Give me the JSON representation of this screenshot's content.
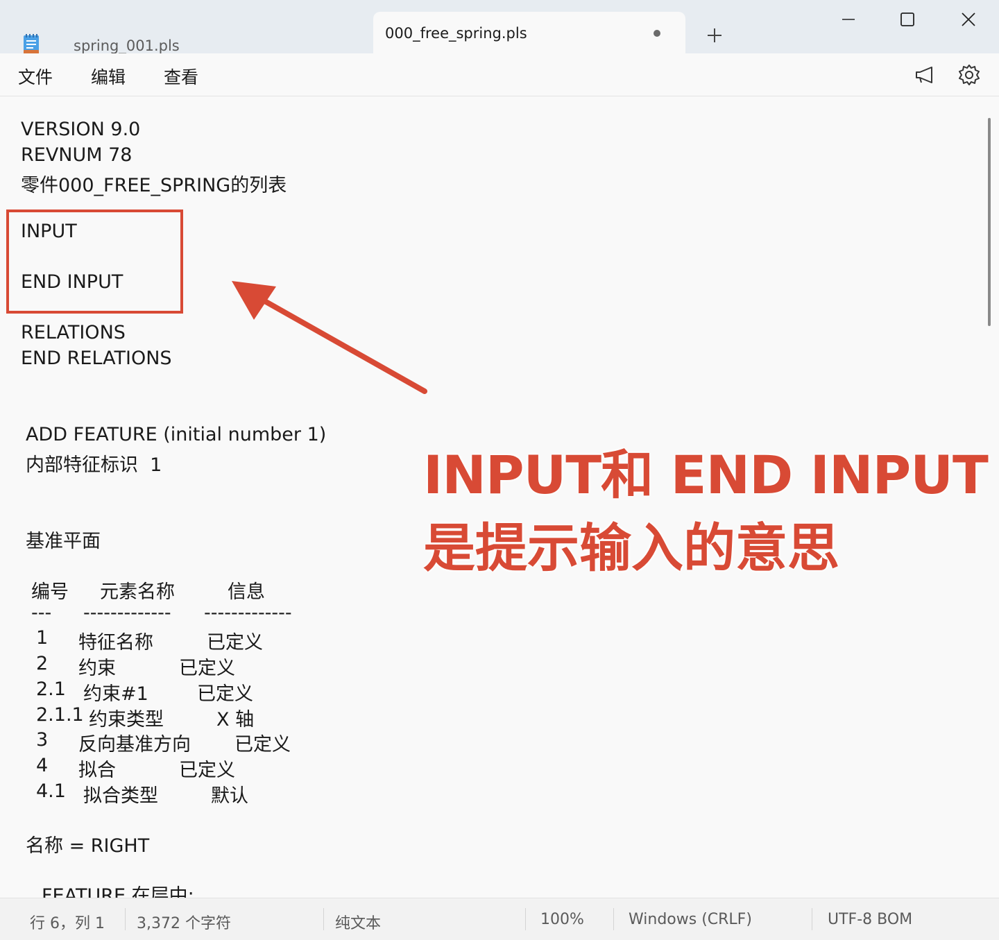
{
  "tabs": [
    {
      "title": "spring_001.pls",
      "active": false
    },
    {
      "title": "000_free_spring.pls",
      "active": true,
      "unsaved": true
    }
  ],
  "new_tab_icon": "plus-icon",
  "window_controls": [
    "minimize-icon",
    "maximize-icon",
    "close-icon"
  ],
  "menu": {
    "file": "文件",
    "edit": "编辑",
    "view": "查看"
  },
  "toolbar_icons": [
    "megaphone-icon",
    "gear-icon"
  ],
  "editor": {
    "lines": [
      "VERSION 9.0",
      "REVNUM 78",
      "零件000_FREE_SPRING的列表",
      "INPUT",
      "END INPUT",
      "RELATIONS",
      "END RELATIONS",
      "ADD FEATURE (initial number 1)",
      "内部特征标识  1",
      "基准平面"
    ],
    "table_header": {
      "col1": "编号",
      "col2": "元素名称",
      "col3": "信息"
    },
    "table_separator": {
      "col1": "---",
      "col2": "-------------",
      "col3": "-------------"
    },
    "table_rows": [
      {
        "id": "1",
        "name": "特征名称",
        "info": "已定义"
      },
      {
        "id": "2",
        "name": "约束",
        "info": "已定义"
      },
      {
        "id": "2.1",
        "name": "约束#1",
        "info": "已定义"
      },
      {
        "id": "2.1.1",
        "name": "约束类型",
        "info": "X 轴"
      },
      {
        "id": "3",
        "name": "反向基准方向",
        "info": "已定义"
      },
      {
        "id": "4",
        "name": "拟合",
        "info": "已定义"
      },
      {
        "id": "4.1",
        "name": "拟合类型",
        "info": "默认"
      }
    ],
    "name_line": "名称 = RIGHT",
    "partial_line": "FEATURE 在层中:"
  },
  "annotation": {
    "line1": "INPUT和 END INPUT",
    "line2": "是提示输入的意思",
    "color": "#d84a35"
  },
  "status": {
    "position": "行 6，列 1",
    "chars": "3,372 个字符",
    "format": "纯文本",
    "zoom": "100%",
    "line_ending": "Windows (CRLF)",
    "encoding": "UTF-8 BOM"
  },
  "colors": {
    "accent": "#d84a35",
    "titlebar": "#e7ecf1",
    "background": "#f9f9f9"
  }
}
